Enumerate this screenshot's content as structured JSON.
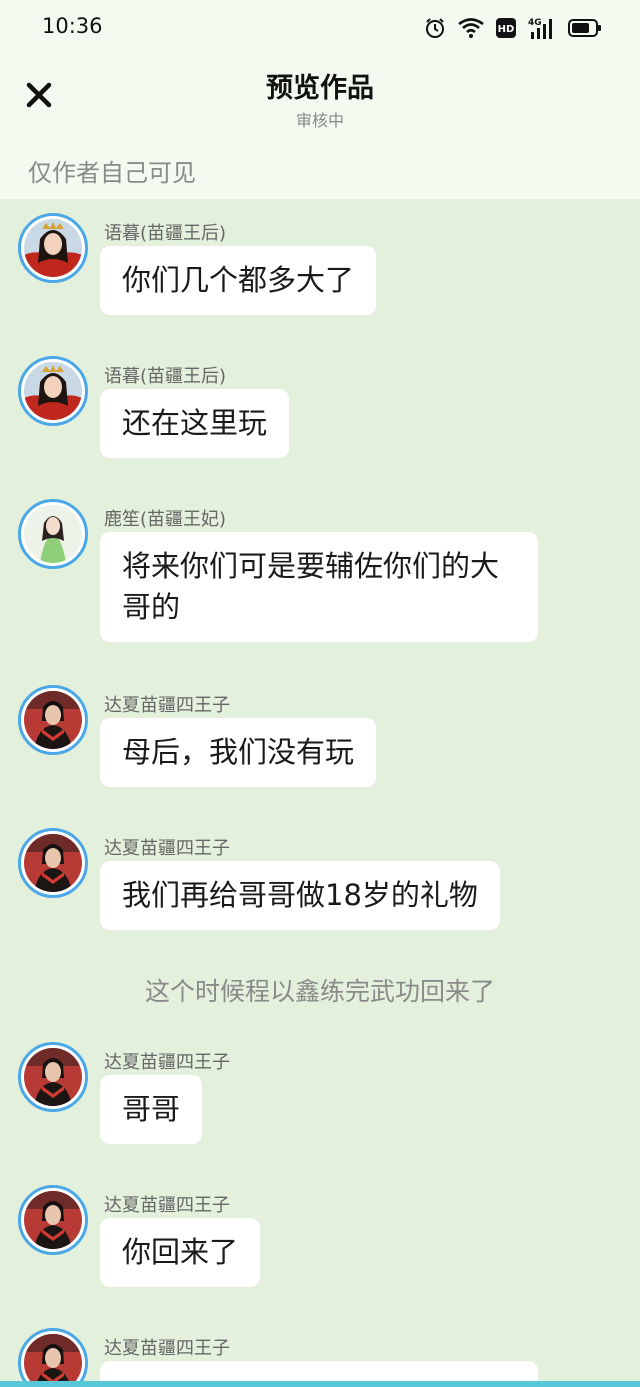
{
  "status_bar": {
    "time": "10:36",
    "icons": [
      "alarm-icon",
      "wifi-icon",
      "hd-icon",
      "signal-4g-icon",
      "battery-icon"
    ],
    "hd_label": "HD",
    "network_label": "4G"
  },
  "header": {
    "close_icon": "close-icon",
    "title": "预览作品",
    "subtitle": "审核中",
    "visibility_note": "仅作者自己可见"
  },
  "colors": {
    "background": "#e3f1dc",
    "header_background": "#f3fbf1",
    "bubble": "#ffffff",
    "avatar_border": "#4aa8e8",
    "muted_text": "#8a8a8a"
  },
  "messages": [
    {
      "sender": "语暮(苗疆王后)",
      "avatar": "queen-avatar",
      "text": "你们几个都多大了"
    },
    {
      "sender": "语暮(苗疆王后)",
      "avatar": "queen-avatar",
      "text": "还在这里玩"
    },
    {
      "sender": "鹿笙(苗疆王妃)",
      "avatar": "consort-avatar",
      "text": "将来你们可是要辅佐你们的大哥的"
    },
    {
      "sender": "达夏苗疆四王子",
      "avatar": "prince-avatar",
      "text": "母后，我们没有玩"
    },
    {
      "sender": "达夏苗疆四王子",
      "avatar": "prince-avatar",
      "text": "我们再给哥哥做18岁的礼物"
    },
    {
      "narration": "这个时候程以鑫练完武功回来了"
    },
    {
      "sender": "达夏苗疆四王子",
      "avatar": "prince-avatar",
      "text": "哥哥"
    },
    {
      "sender": "达夏苗疆四王子",
      "avatar": "prince-avatar",
      "text": "你回来了"
    },
    {
      "sender": "达夏苗疆四王子",
      "avatar": "prince-avatar",
      "text": ""
    }
  ]
}
